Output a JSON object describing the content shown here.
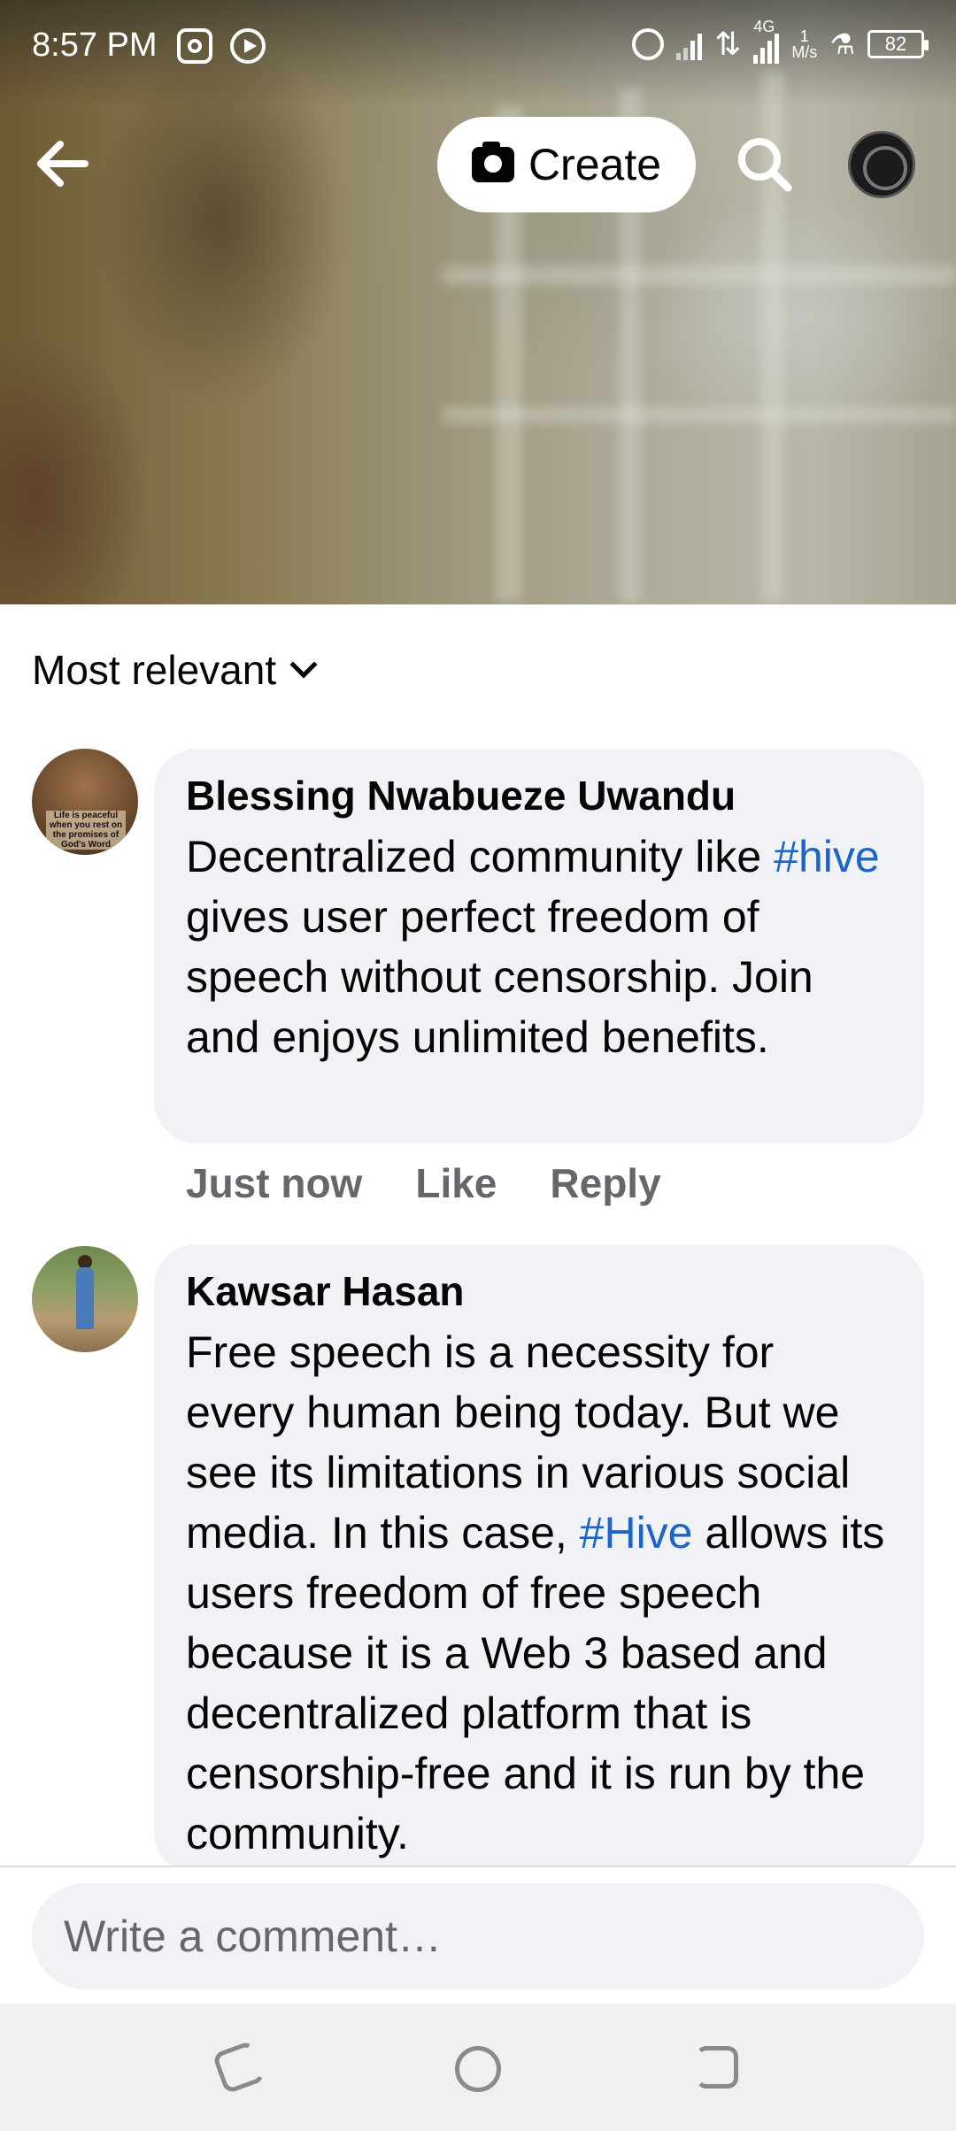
{
  "status_bar": {
    "time": "8:57 PM",
    "network_type": "4G",
    "speed_value": "1",
    "speed_unit": "M/s",
    "battery": "82",
    "icons": [
      "instagram-icon",
      "play-icon",
      "alarm-icon",
      "signal-icon",
      "data-transfer-icon",
      "signal-4g-icon",
      "flask-icon",
      "battery-icon"
    ]
  },
  "top_nav": {
    "create_label": "Create",
    "icons": [
      "back-arrow-icon",
      "camera-icon",
      "search-icon",
      "profile-avatar"
    ]
  },
  "comments_header": {
    "sort_label": "Most relevant"
  },
  "comments": [
    {
      "author": "Blessing Nwabueze Uwandu",
      "avatar_caption": "Life is peaceful when you rest on the promises of God's Word",
      "text_before": "Decentralized community like ",
      "hashtag": "#hive",
      "text_after": " gives user perfect freedom of speech without censorship. Join and enjoys unlimited benefits.",
      "time": "Just now",
      "like_label": "Like",
      "reply_label": "Reply"
    },
    {
      "author": "Kawsar Hasan",
      "text_before": "Free speech is a necessity for every human being today.  But we see its limitations in various social media.  In this case, ",
      "hashtag": "#Hive",
      "text_after": " allows its users freedom of free speech because it is a Web 3 based and decentralized platform that is censorship-free and it is run by the community."
    }
  ],
  "composer": {
    "placeholder": "Write a comment…"
  },
  "colors": {
    "hashtag": "#1b65c9",
    "bubble_bg": "#f0f2f5",
    "meta_text": "#65676b"
  }
}
